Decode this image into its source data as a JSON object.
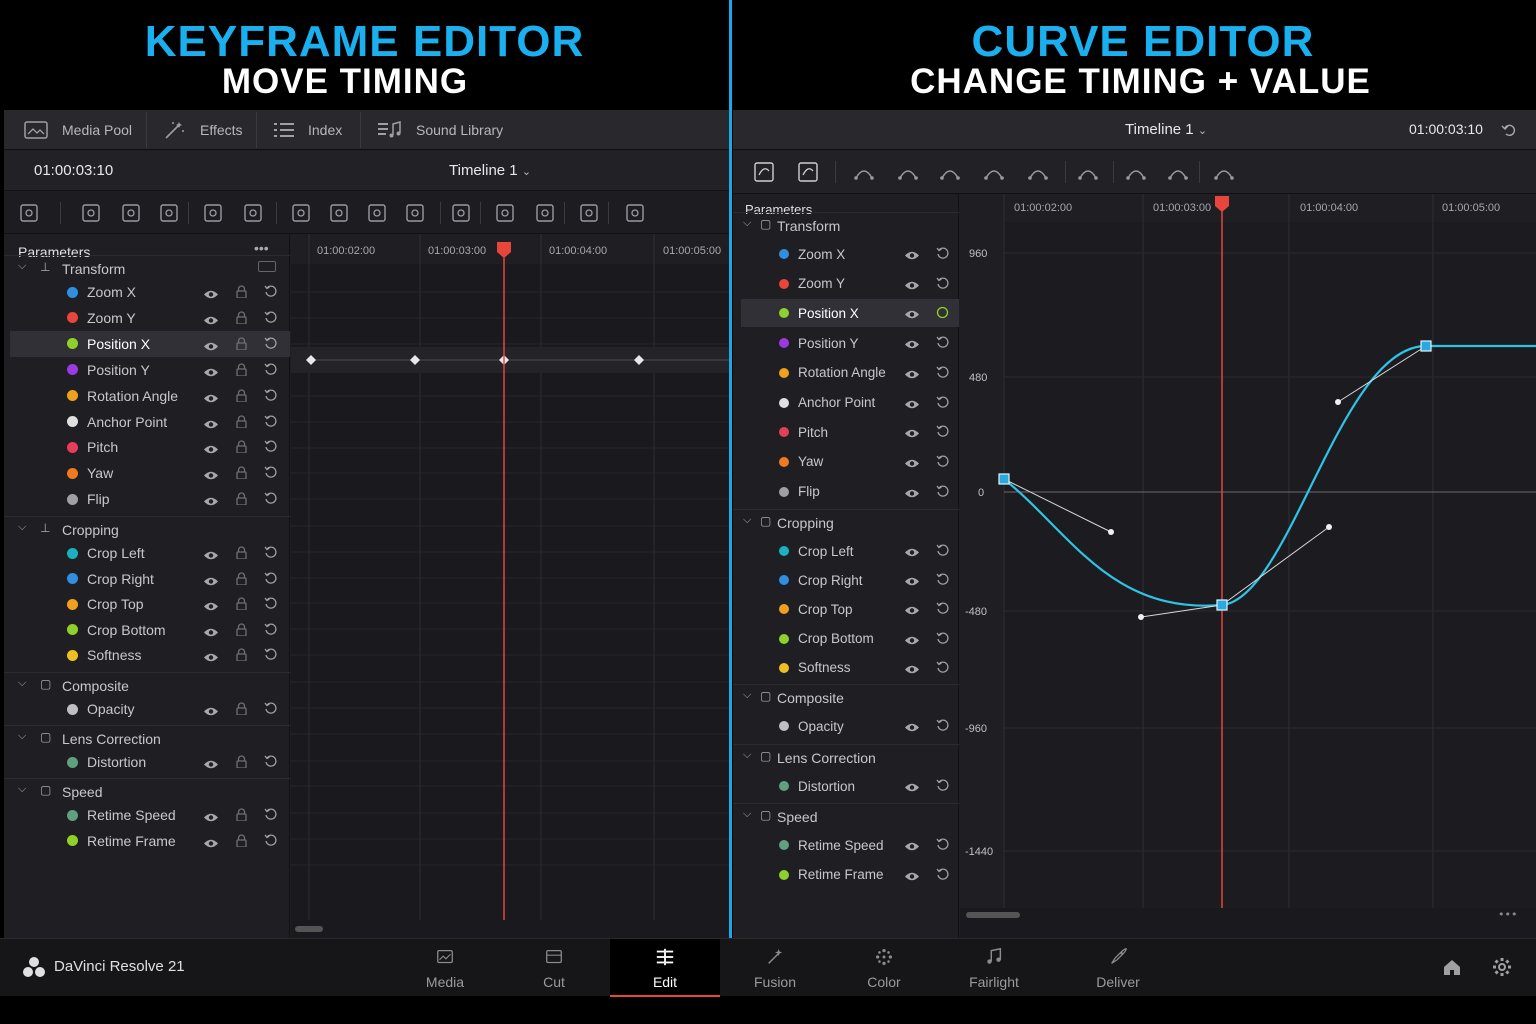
{
  "headings": {
    "left_title": "KEYFRAME EDITOR",
    "left_subtitle": "MOVE TIMING",
    "right_title": "CURVE EDITOR",
    "right_subtitle": "CHANGE TIMING + VALUE"
  },
  "left_panel": {
    "nav": [
      {
        "label": "Media Pool",
        "icon": "media-pool-icon"
      },
      {
        "label": "Effects",
        "icon": "effects-wand-icon"
      },
      {
        "label": "Index",
        "icon": "index-list-icon"
      },
      {
        "label": "Sound Library",
        "icon": "sound-library-icon"
      }
    ],
    "timecode": "01:00:03:10",
    "timeline_name": "Timeline 1",
    "params_header": "Parameters",
    "more": "•••",
    "ruler": [
      "01:00:02:00",
      "01:00:03:00",
      "01:00:04:00",
      "01:00:05:00"
    ]
  },
  "right_panel": {
    "timeline_name": "Timeline 1",
    "timecode": "01:00:03:10",
    "params_header": "Parameters",
    "ruler": [
      "01:00:02:00",
      "01:00:03:00",
      "01:00:04:00",
      "01:00:05:00"
    ],
    "y_ticks": [
      "960",
      "480",
      "0",
      "-480",
      "-960",
      "-1440"
    ],
    "more": "•••"
  },
  "groups": [
    {
      "name": "Transform",
      "items": [
        {
          "label": "Zoom X",
          "color": "#2f8fe0"
        },
        {
          "label": "Zoom Y",
          "color": "#e8453c"
        },
        {
          "label": "Position X",
          "color": "#8fd12a",
          "selected": true
        },
        {
          "label": "Position Y",
          "color": "#9a3ae0"
        },
        {
          "label": "Rotation Angle",
          "color": "#f0a020"
        },
        {
          "label": "Anchor Point",
          "color": "#e0e0e0"
        },
        {
          "label": "Pitch",
          "color": "#e83c5c"
        },
        {
          "label": "Yaw",
          "color": "#f07a20"
        },
        {
          "label": "Flip",
          "color": "#a0a0a4"
        }
      ]
    },
    {
      "name": "Cropping",
      "items": [
        {
          "label": "Crop Left",
          "color": "#1ab0c0"
        },
        {
          "label": "Crop Right",
          "color": "#2f8fe0"
        },
        {
          "label": "Crop Top",
          "color": "#f0a020"
        },
        {
          "label": "Crop Bottom",
          "color": "#8fd12a"
        },
        {
          "label": "Softness",
          "color": "#f0c020"
        }
      ]
    },
    {
      "name": "Composite",
      "items": [
        {
          "label": "Opacity",
          "color": "#c0c0c4"
        }
      ]
    },
    {
      "name": "Lens Correction",
      "items": [
        {
          "label": "Distortion",
          "color": "#60a080"
        }
      ]
    },
    {
      "name": "Speed",
      "items": [
        {
          "label": "Retime Speed",
          "color": "#60a080"
        },
        {
          "label": "Retime Frame",
          "color": "#8fd12a"
        }
      ]
    }
  ],
  "bottom_bar": {
    "app_name": "DaVinci Resolve 21",
    "tabs": [
      {
        "label": "Media",
        "icon": "media-page-icon"
      },
      {
        "label": "Cut",
        "icon": "cut-page-icon"
      },
      {
        "label": "Edit",
        "icon": "edit-page-icon",
        "active": true
      },
      {
        "label": "Fusion",
        "icon": "fusion-page-icon"
      },
      {
        "label": "Color",
        "icon": "color-page-icon"
      },
      {
        "label": "Fairlight",
        "icon": "fairlight-page-icon"
      },
      {
        "label": "Deliver",
        "icon": "deliver-page-icon"
      }
    ]
  },
  "colors": {
    "accent": "#1ab0f0",
    "playhead": "#e8453c",
    "curve": "#2ec4e8",
    "active_tab_underline": "#e8453c"
  }
}
